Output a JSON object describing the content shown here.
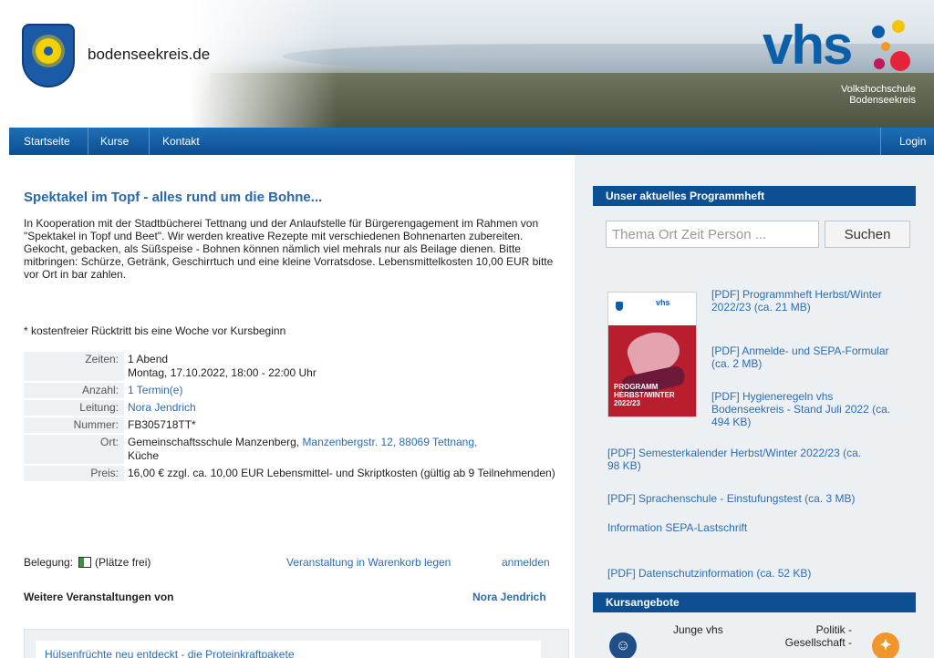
{
  "header": {
    "site_name": "bodenseekreis.de",
    "brand": "vhs",
    "brand_sub_1": "Volkshochschule",
    "brand_sub_2": "Bodenseekreis"
  },
  "nav": {
    "items": [
      "Startseite",
      "Kurse",
      "Kontakt"
    ],
    "login": "Login"
  },
  "course": {
    "title": "Spektakel im Topf - alles rund um die Bohne...",
    "description": "In Kooperation mit der Stadtbücherei Tettnang und der Anlaufstelle für Bürgerengagement im Rahmen von \"Spektakel in Topf und Beet\". Wir werden kreative Rezepte mit verschiedenen Bohnenarten zubereiten. Gekocht, gebacken, als Süßspeise - Bohnen können nämlich viel mehrals nur als Beilage dienen. Bitte mitbringen: Schürze, Getränk, Geschirrtuch und eine kleine Vorratsdose. Lebensmittelkosten 10,00 EUR bitte vor Ort in bar zahlen.",
    "note": "* kostenfreier Rücktritt bis eine Woche vor Kursbeginn",
    "details": {
      "zeiten_label": "Zeiten:",
      "zeiten_value_1": "1 Abend",
      "zeiten_value_2": "Montag, 17.10.2022, 18:00 - 22:00 Uhr",
      "anzahl_label": "Anzahl:",
      "anzahl_value": "1 Termin(e)",
      "leitung_label": "Leitung:",
      "leitung_value": "Nora Jendrich",
      "nummer_label": "Nummer:",
      "nummer_value": "FB305718TT*",
      "ort_label": "Ort:",
      "ort_value_1": "Gemeinschaftsschule Manzenberg, ",
      "ort_link": "Manzenbergstr. 12, 88069 Tettnang,",
      "ort_value_2": "Küche",
      "preis_label": "Preis:",
      "preis_value": "16,00 € zzgl. ca. 10,00 EUR Lebensmittel- und Skriptkosten (gültig ab 9 Teilnehmenden)"
    },
    "belegung_label": "Belegung:",
    "belegung_value": "(Plätze frei)",
    "belegung_fill": 0.35,
    "warenkorb": "Veranstaltung in Warenkorb legen",
    "anmelden": "anmelden",
    "weitere": "Weitere Veranstaltungen von",
    "weitere_name": "Nora Jendrich",
    "related": "Hülsenfrüchte neu entdeckt - die Proteinkraftpakete"
  },
  "sidebar": {
    "programm_title": "Unser aktuelles Programmheft",
    "search_placeholder": "Thema Ort Zeit Person ...",
    "search_button": "Suchen",
    "cover_logo": "vhs",
    "cover_text_1": "PROGRAMM",
    "cover_text_2": "HERBST/WINTER 2022/23",
    "pdf_1": "[PDF] Programmheft Herbst/Winter 2022/23 (ca. 21 MB)",
    "pdf_2": "[PDF] Anmelde- und SEPA-Formular (ca. 2 MB)",
    "pdf_3": "[PDF] Hygieneregeln vhs Bodenseekreis - Stand Juli 2022 (ca. 494 KB)",
    "pdf_4": "[PDF] Semesterkalender Herbst/Winter 2022/23 (ca. 98 KB)",
    "pdf_5": "[PDF] Sprachenschule - Einstufungstest (ca. 3 MB)",
    "sepa_info": "Information SEPA-Lastschrift",
    "pdf_6": "[PDF] Datenschutzinformation (ca. 52 KB)",
    "kurs_title": "Kursangebote",
    "kurs_1": "Junge vhs",
    "kurs_2_1": "Politik -",
    "kurs_2_2": "Gesellschaft -"
  },
  "colors": {
    "nav_blue": "#0c4f92",
    "link_blue": "#2a6db5",
    "brand_blue": "#0b5ea8",
    "accent_orange": "#f0962a"
  }
}
